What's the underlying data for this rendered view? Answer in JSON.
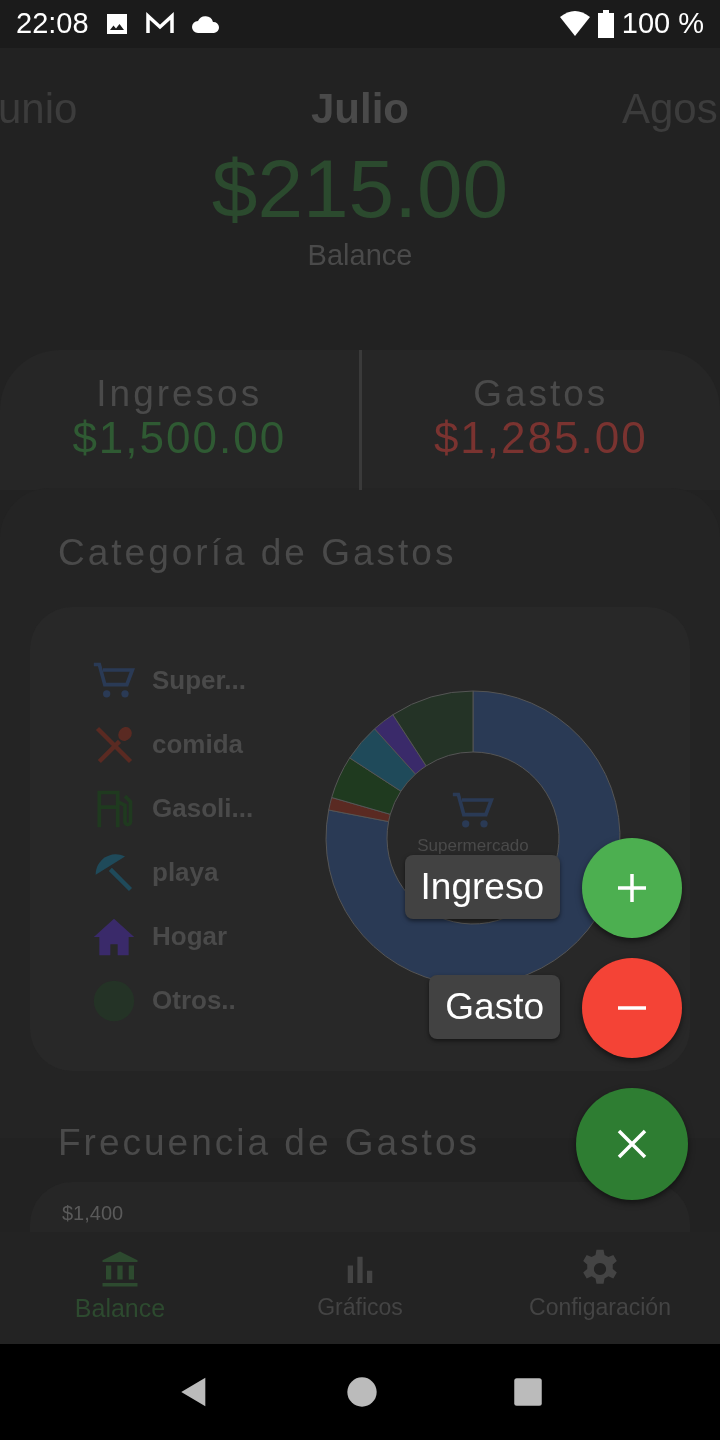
{
  "status_bar": {
    "time": "22:08",
    "battery": "100 %"
  },
  "months": [
    {
      "label": "unio",
      "selected": false
    },
    {
      "label": "Julio",
      "selected": true
    },
    {
      "label": "Agos",
      "selected": false
    }
  ],
  "balance": {
    "amount": "$215.00",
    "label": "Balance"
  },
  "summary": [
    {
      "label": "Ingresos",
      "amount": "$1,500.00",
      "kind": "income"
    },
    {
      "label": "Gastos",
      "amount": "$1,285.00",
      "kind": "expense"
    }
  ],
  "categories": {
    "title": "Categoría de Gastos",
    "items": [
      {
        "label": "Super...",
        "kind": "cart",
        "color": "#2a3a55"
      },
      {
        "label": "comida",
        "kind": "food",
        "color": "#5a2a22"
      },
      {
        "label": "Gasoli...",
        "kind": "fuel",
        "color": "#1f3a1f"
      },
      {
        "label": "playa",
        "kind": "beach",
        "color": "#1f4a5a"
      },
      {
        "label": "Hogar",
        "kind": "home",
        "color": "#3a2a6a"
      },
      {
        "label": "Otros..",
        "kind": "other",
        "color": "#243326"
      }
    ],
    "center_label": "Supermercado"
  },
  "frequency": {
    "title": "Frecuencia de Gastos",
    "axis_label": "$1,400"
  },
  "fab_actions": [
    {
      "label": "Ingreso",
      "kind": "add"
    },
    {
      "label": "Gasto",
      "kind": "remove"
    }
  ],
  "bottom_nav": [
    {
      "label": "Balance",
      "kind": "bank",
      "selected": true
    },
    {
      "label": "Gráficos",
      "kind": "chart",
      "selected": false
    },
    {
      "label": "Configaración",
      "kind": "gear",
      "selected": false
    }
  ]
}
